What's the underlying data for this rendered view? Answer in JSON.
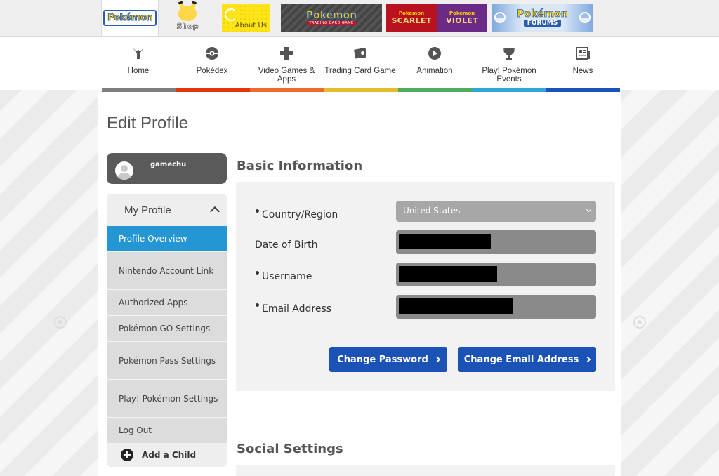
{
  "site_bar": {
    "pokemon_logo": "Pokémon",
    "shop_label": "Shop",
    "about_label": "About Us",
    "tcg_logo": "Pokémon",
    "tcg_sub": "TRADING CARD GAME",
    "scarlet_mini": "Pokémon",
    "scarlet_label": "SCARLET",
    "violet_mini": "Pokémon",
    "violet_label": "VIOLET",
    "forums_logo": "Pokémon",
    "forums_sub": "FORUMS"
  },
  "nav": {
    "items": [
      {
        "label": "Home",
        "icon": "home-icon"
      },
      {
        "label": "Pokédex",
        "icon": "pokeball-icon"
      },
      {
        "label": "Video Games & Apps",
        "icon": "dpad-icon"
      },
      {
        "label": "Trading Card Game",
        "icon": "cards-icon"
      },
      {
        "label": "Animation",
        "icon": "play-icon"
      },
      {
        "label": "Play! Pokémon Events",
        "icon": "trophy-icon"
      },
      {
        "label": "News",
        "icon": "newspaper-icon"
      }
    ],
    "strip_colors": [
      "#7f7f7f",
      "#e3350d",
      "#ee6b2f",
      "#e6bc2f",
      "#4dad5b",
      "#30a7d7",
      "#1b53ba"
    ]
  },
  "page": {
    "title": "Edit Profile"
  },
  "user": {
    "name": "gamechu"
  },
  "sidebar": {
    "header": "My Profile",
    "items": [
      {
        "label": "Profile Overview",
        "active": true
      },
      {
        "label": "Nintendo Account Link"
      },
      {
        "label": "Authorized Apps"
      },
      {
        "label": "Pokémon GO Settings"
      },
      {
        "label": "Pokémon Pass Settings"
      },
      {
        "label": "Play! Pokémon Settings"
      },
      {
        "label": "Log Out"
      }
    ],
    "add_child": "Add a Child"
  },
  "basic_info": {
    "title": "Basic Information",
    "country_label": "Country/Region",
    "country_value": "United States",
    "dob_label": "Date of Birth",
    "username_label": "Username",
    "email_label": "Email Address",
    "change_password": "Change Password",
    "change_email": "Change Email Address"
  },
  "social": {
    "title": "Social Settings"
  },
  "colors": {
    "active_item": "#2596d4",
    "button": "#1b52b5"
  }
}
